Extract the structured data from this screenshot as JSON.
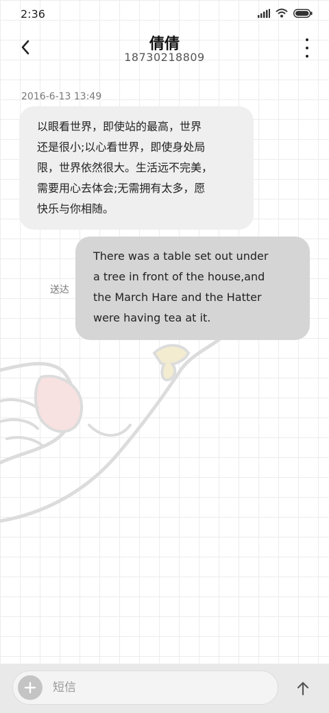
{
  "status_bar": {
    "time": "2:36",
    "icons": [
      "signal-icon",
      "wifi-icon",
      "battery-icon"
    ]
  },
  "header": {
    "title": "倩倩",
    "phone": "18730218809"
  },
  "messages": [
    {
      "direction": "incoming",
      "timestamp": "2016-6-13 13:49",
      "lines": [
        "以眼看世界，即使站的最高，世界",
        "还是很小;以心看世界，即使身处局",
        "限，世界依然很大。生活远不完美，",
        "需要用心去体会;无需拥有太多，愿",
        "快乐与你相随。"
      ]
    },
    {
      "direction": "outgoing",
      "status": "送达",
      "lines": [
        "There was a table set out under",
        "a tree in front of the house,and",
        "the March Hare and the Hatter",
        "were having tea at it."
      ]
    }
  ],
  "composer": {
    "placeholder": "短信",
    "value": ""
  },
  "colors": {
    "incoming_bubble": "#efefef",
    "outgoing_bubble": "#d5d5d5",
    "bottom_bar": "#e9e9e9"
  }
}
